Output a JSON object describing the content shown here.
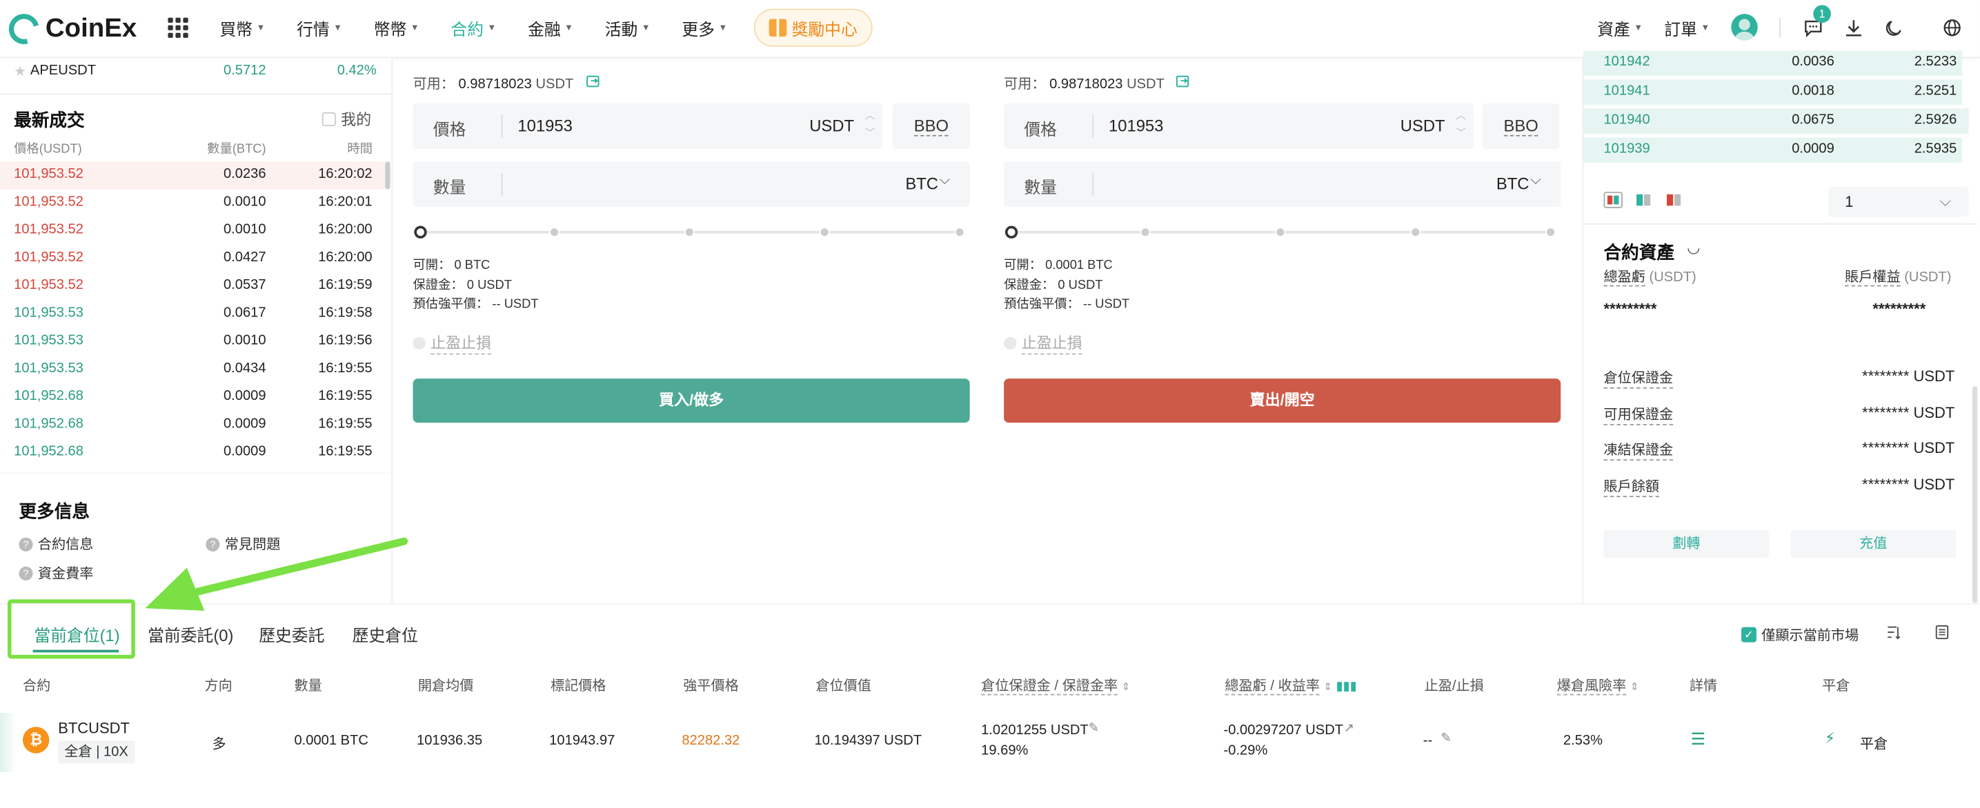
{
  "header": {
    "brand": "CoinEx",
    "nav": [
      {
        "label": "買幣"
      },
      {
        "label": "行情"
      },
      {
        "label": "幣幣"
      },
      {
        "label": "合約"
      },
      {
        "label": "金融"
      },
      {
        "label": "活動"
      },
      {
        "label": "更多"
      }
    ],
    "reward_label": "獎勵中心",
    "assets_label": "資產",
    "orders_label": "訂單",
    "notification_count": "1",
    "accent_color": "#2fb39f"
  },
  "left": {
    "top_ticker": {
      "symbol": "APEUSDT",
      "price": "0.5712",
      "change": "0.42%"
    },
    "trades": {
      "title": "最新成交",
      "mine_label": "我的",
      "col_price": "價格(USDT)",
      "col_qty": "數量(BTC)",
      "col_time": "時間",
      "rows": [
        {
          "price": "101,953.52",
          "qty": "0.0236",
          "time": "16:20:02",
          "side": "sell"
        },
        {
          "price": "101,953.52",
          "qty": "0.0010",
          "time": "16:20:01",
          "side": "sell"
        },
        {
          "price": "101,953.52",
          "qty": "0.0010",
          "time": "16:20:00",
          "side": "sell"
        },
        {
          "price": "101,953.52",
          "qty": "0.0427",
          "time": "16:20:00",
          "side": "sell"
        },
        {
          "price": "101,953.52",
          "qty": "0.0537",
          "time": "16:19:59",
          "side": "sell"
        },
        {
          "price": "101,953.53",
          "qty": "0.0617",
          "time": "16:19:58",
          "side": "buy"
        },
        {
          "price": "101,953.53",
          "qty": "0.0010",
          "time": "16:19:56",
          "side": "buy"
        },
        {
          "price": "101,953.53",
          "qty": "0.0434",
          "time": "16:19:55",
          "side": "buy"
        },
        {
          "price": "101,952.68",
          "qty": "0.0009",
          "time": "16:19:55",
          "side": "buy"
        },
        {
          "price": "101,952.68",
          "qty": "0.0009",
          "time": "16:19:55",
          "side": "buy"
        },
        {
          "price": "101,952.68",
          "qty": "0.0009",
          "time": "16:19:55",
          "side": "buy"
        }
      ]
    },
    "more_info": {
      "title": "更多信息",
      "contract_info": "合約信息",
      "faq": "常見問題",
      "funding_rate": "資金費率"
    }
  },
  "buy": {
    "avail_label": "可用：",
    "avail_value": "0.98718023",
    "avail_unit": "USDT",
    "price_label": "價格",
    "price_value": "101953",
    "price_unit": "USDT",
    "bbo": "BBO",
    "qty_label": "數量",
    "qty_unit": "BTC",
    "open_label": "可開：",
    "open_value": "0 BTC",
    "margin_label": "保證金：",
    "margin_value": "0 USDT",
    "liq_label": "預估強平價：",
    "liq_value": "-- USDT",
    "tpsl": "止盈止損",
    "button": "買入/做多",
    "color": "#4ea996"
  },
  "sell": {
    "avail_label": "可用：",
    "avail_value": "0.98718023",
    "avail_unit": "USDT",
    "price_label": "價格",
    "price_value": "101953",
    "price_unit": "USDT",
    "bbo": "BBO",
    "qty_label": "數量",
    "qty_unit": "BTC",
    "open_label": "可開：",
    "open_value": "0.0001 BTC",
    "margin_label": "保證金：",
    "margin_value": "0 USDT",
    "liq_label": "預估強平價：",
    "liq_value": "-- USDT",
    "tpsl": "止盈止損",
    "button": "賣出/開空",
    "color": "#cd5a48"
  },
  "orderbook": {
    "rows": [
      {
        "price": "101942",
        "qty": "0.0036",
        "total": "2.5233"
      },
      {
        "price": "101941",
        "qty": "0.0018",
        "total": "2.5251"
      },
      {
        "price": "101940",
        "qty": "0.0675",
        "total": "2.5926"
      },
      {
        "price": "101939",
        "qty": "0.0009",
        "total": "2.5935"
      }
    ],
    "precision": "1"
  },
  "contract_assets": {
    "title": "合約資產",
    "total_pnl_label": "總盈虧",
    "total_pnl_unit": "(USDT)",
    "equity_label": "賬戶權益",
    "equity_unit": "(USDT)",
    "masked": "*********",
    "rows": [
      {
        "label": "倉位保證金",
        "value": "******** USDT"
      },
      {
        "label": "可用保證金",
        "value": "******** USDT"
      },
      {
        "label": "凍結保證金",
        "value": "******** USDT"
      },
      {
        "label": "賬戶餘額",
        "value": "******** USDT"
      }
    ],
    "transfer": "劃轉",
    "deposit": "充值"
  },
  "bottom": {
    "tabs": [
      "當前倉位(1)",
      "當前委託(0)",
      "歷史委託",
      "歷史倉位"
    ],
    "only_current": "僅顯示當前市場",
    "columns": [
      "合約",
      "方向",
      "數量",
      "開倉均價",
      "標記價格",
      "強平價格",
      "倉位價值",
      "倉位保證金 / 保證金率",
      "總盈虧 / 收益率",
      "止盈/止損",
      "爆倉風險率",
      "詳情",
      "平倉"
    ],
    "position": {
      "symbol": "BTCUSDT",
      "leverage": "全倉 | 10X",
      "side": "多",
      "qty": "0.0001 BTC",
      "entry": "101936.35",
      "mark": "101943.97",
      "liq": "82282.32",
      "value": "10.194397 USDT",
      "margin": "1.0201255 USDT",
      "margin_rate": "19.69%",
      "pnl": "-0.00297207 USDT",
      "roe": "-0.29%",
      "tpsl": "--",
      "risk": "2.53%",
      "close": "平倉"
    }
  }
}
